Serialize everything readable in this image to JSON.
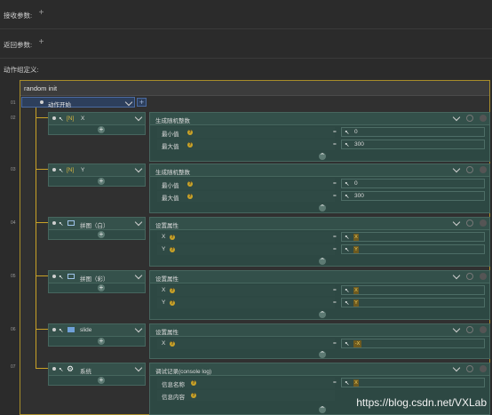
{
  "top": {
    "receive_params": "接收参数:",
    "return_params": "返回参数:",
    "action_def": "动作组定义:"
  },
  "panel": {
    "title": "random init"
  },
  "line_numbers": [
    "01",
    "02",
    "03",
    "04",
    "05",
    "06",
    "07"
  ],
  "start": {
    "label": "动作开始"
  },
  "nodes": [
    {
      "target_tag": "[N]",
      "target": "X",
      "action": "生成随机整数",
      "rows": [
        {
          "label": "最小值",
          "value": "0"
        },
        {
          "label": "最大值",
          "value": "300"
        }
      ]
    },
    {
      "target_tag": "[N]",
      "target": "Y",
      "action": "生成随机整数",
      "rows": [
        {
          "label": "最小值",
          "value": "0"
        },
        {
          "label": "最大值",
          "value": "300"
        }
      ]
    },
    {
      "target": "拼图（白）",
      "action": "设置属性",
      "rows": [
        {
          "label": "X",
          "value": "X"
        },
        {
          "label": "Y",
          "value": "Y"
        }
      ]
    },
    {
      "target": "拼图（彩）",
      "action": "设置属性",
      "rows": [
        {
          "label": "X",
          "value": "X"
        },
        {
          "label": "Y",
          "value": "Y"
        }
      ]
    },
    {
      "target": "slide",
      "action": "设置属性",
      "rows": [
        {
          "label": "X",
          "value": "-X"
        }
      ]
    },
    {
      "target": "系统",
      "action": "调试记录(console log)",
      "rows": [
        {
          "label": "信息名称",
          "value": "X"
        },
        {
          "label": "信息内容",
          "value": ""
        }
      ]
    }
  ],
  "watermark": "https://blog.csdn.net/VXLab",
  "colors": {
    "accent_gold": "#c9a227",
    "card_green": "#2f4a45",
    "start_blue": "#2d3f5c"
  },
  "icons": {
    "cursor": "cursor-icon",
    "chevron": "chevron-down-icon",
    "plus": "plus-icon",
    "question": "help-icon",
    "gear": "gear-icon",
    "image": "image-icon",
    "folder": "folder-icon"
  }
}
